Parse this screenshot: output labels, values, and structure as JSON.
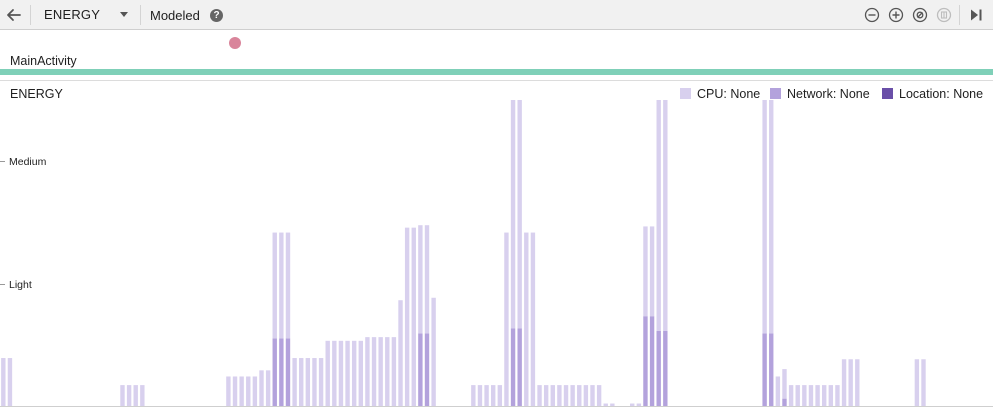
{
  "toolbar": {
    "stage_label": "ENERGY",
    "mode_label": "Modeled",
    "help_glyph": "?"
  },
  "events": {
    "activity_label": "MainActivity"
  },
  "panel": {
    "title": "ENERGY"
  },
  "legend": [
    {
      "label": "CPU: None",
      "color": "#d8d0ee"
    },
    {
      "label": "Network: None",
      "color": "#b3a2dc"
    },
    {
      "label": "Location: None",
      "color": "#6a4fa8"
    }
  ],
  "icons": [
    "back-arrow-icon",
    "dropdown-chevron-icon",
    "help-icon",
    "zoom-out-icon",
    "zoom-in-icon",
    "reset-zoom-icon",
    "pause-icon",
    "go-live-icon"
  ],
  "chart_data": {
    "type": "bar",
    "stacked": true,
    "y_levels": [
      "Light",
      "Medium"
    ],
    "ylim": [
      0,
      3
    ],
    "series": [
      {
        "name": "CPU",
        "color": "#d8d0ee"
      },
      {
        "name": "Network",
        "color": "#b3a2dc"
      },
      {
        "name": "Location",
        "color": "#6a4fa8"
      }
    ],
    "x": [
      1,
      2,
      19,
      20,
      21,
      22,
      35,
      36,
      37,
      38,
      39,
      40,
      41,
      42,
      43,
      44,
      45,
      46,
      47,
      48,
      49,
      50,
      51,
      52,
      53,
      54,
      55,
      56,
      57,
      58,
      59,
      60,
      61,
      62,
      63,
      64,
      65,
      66,
      72,
      73,
      74,
      75,
      76,
      77,
      78,
      79,
      80,
      81,
      82,
      83,
      84,
      85,
      86,
      87,
      88,
      89,
      90,
      91,
      92,
      93,
      96,
      97,
      98,
      99,
      100,
      101,
      116,
      117,
      118,
      119,
      120,
      121,
      122,
      123,
      124,
      125,
      126,
      127,
      128,
      129,
      130,
      139,
      140,
      141,
      142,
      143
    ],
    "cpu": [
      0.39,
      0.39,
      0.17,
      0.17,
      0.17,
      0.17,
      0.24,
      0.24,
      0.24,
      0.24,
      0.24,
      0.29,
      0.29,
      0.86,
      0.86,
      0.86,
      0.39,
      0.39,
      0.39,
      0.39,
      0.39,
      0.53,
      0.53,
      0.53,
      0.53,
      0.53,
      0.53,
      0.56,
      0.56,
      0.56,
      0.56,
      0.56,
      0.86,
      1.45,
      1.45,
      0.88,
      0.88,
      0.88,
      0.17,
      0.17,
      0.17,
      0.17,
      0.17,
      1.41,
      2.03,
      2.03,
      1.41,
      1.41,
      0.17,
      0.17,
      0.17,
      0.17,
      0.17,
      0.17,
      0.17,
      0.17,
      0.17,
      0.17,
      0.02,
      0.02,
      0.02,
      0.02,
      0.73,
      0.73,
      2.41,
      2.41,
      2.41,
      2.41,
      0.24,
      0.24,
      0.17,
      0.17,
      0.17,
      0.17,
      0.17,
      0.17,
      0.17,
      0.17,
      0.38,
      0.38,
      0.38,
      0.38,
      0.38
    ],
    "network": [
      0,
      0,
      0,
      0,
      0,
      0,
      0,
      0,
      0,
      0,
      0,
      0,
      0,
      0.55,
      0.55,
      0.55,
      0,
      0,
      0,
      0,
      0,
      0,
      0,
      0,
      0,
      0,
      0,
      0,
      0,
      0,
      0,
      0,
      0,
      0,
      0,
      0.59,
      0.59,
      0,
      0,
      0,
      0,
      0,
      0,
      0,
      0.63,
      0.63,
      0,
      0,
      0,
      0,
      0,
      0,
      0,
      0,
      0,
      0,
      0,
      0,
      0,
      0,
      0,
      0,
      0.73,
      0.73,
      0.61,
      0.61,
      0.59,
      0.59,
      0,
      0.06,
      0,
      0,
      0,
      0,
      0,
      0,
      0,
      0,
      0,
      0,
      0,
      0,
      0
    ],
    "location": [
      0,
      0,
      0,
      0,
      0,
      0,
      0,
      0,
      0,
      0,
      0,
      0,
      0,
      0,
      0,
      0,
      0,
      0,
      0,
      0,
      0,
      0,
      0,
      0,
      0,
      0,
      0,
      0,
      0,
      0,
      0,
      0,
      0,
      0,
      0,
      0,
      0,
      0,
      0,
      0,
      0,
      0,
      0,
      0,
      0,
      0,
      0,
      0,
      0,
      0,
      0,
      0,
      0,
      0,
      0,
      0,
      0,
      0,
      0,
      0,
      0,
      0,
      0,
      0,
      0,
      0,
      0,
      0,
      0,
      0,
      0,
      0,
      0,
      0,
      0,
      0,
      0,
      0,
      0,
      0,
      0,
      0,
      0
    ]
  }
}
